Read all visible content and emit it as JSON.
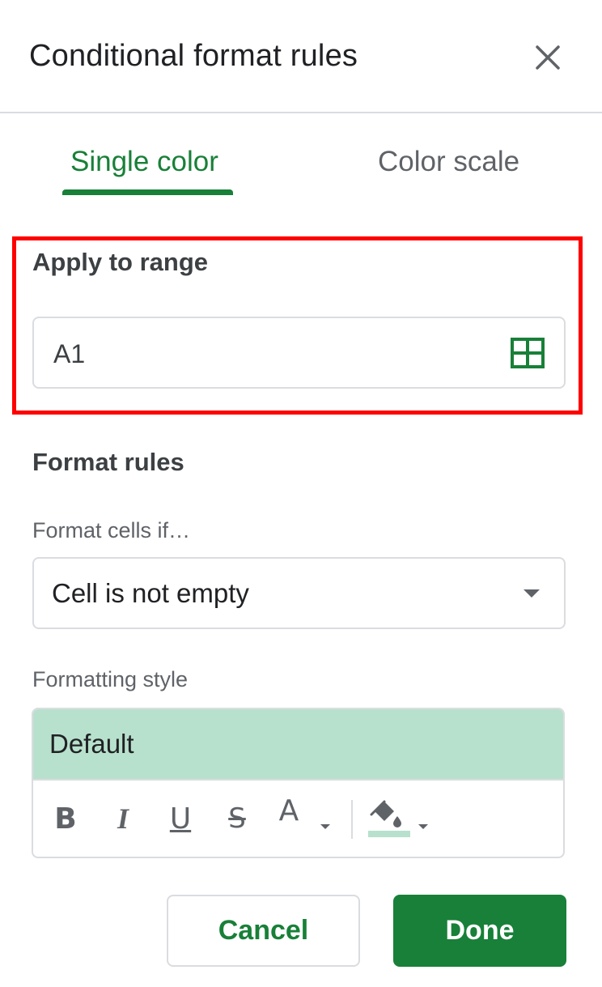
{
  "panel": {
    "title": "Conditional format rules",
    "close_icon": "close-icon"
  },
  "tabs": [
    {
      "label": "Single color",
      "selected": true
    },
    {
      "label": "Color scale",
      "selected": false
    }
  ],
  "range": {
    "label": "Apply to range",
    "value": "A1",
    "select_icon": "grid-icon"
  },
  "rules": {
    "label": "Format rules",
    "condition_label": "Format cells if…",
    "condition_value": "Cell is not empty"
  },
  "style": {
    "label": "Formatting style",
    "preview_text": "Default",
    "preview_background": "#b7e1cd",
    "tools": [
      {
        "name": "bold-icon",
        "glyph": "B"
      },
      {
        "name": "italic-icon",
        "glyph": "I"
      },
      {
        "name": "underline-icon",
        "glyph": "U"
      },
      {
        "name": "strikethrough-icon",
        "glyph": "S"
      },
      {
        "name": "text-color-icon",
        "glyph": "A"
      },
      {
        "name": "fill-color-icon",
        "glyph": ""
      }
    ]
  },
  "actions": {
    "cancel_label": "Cancel",
    "done_label": "Done"
  },
  "colors": {
    "accent": "#188038",
    "highlight_border": "#ff0000"
  }
}
